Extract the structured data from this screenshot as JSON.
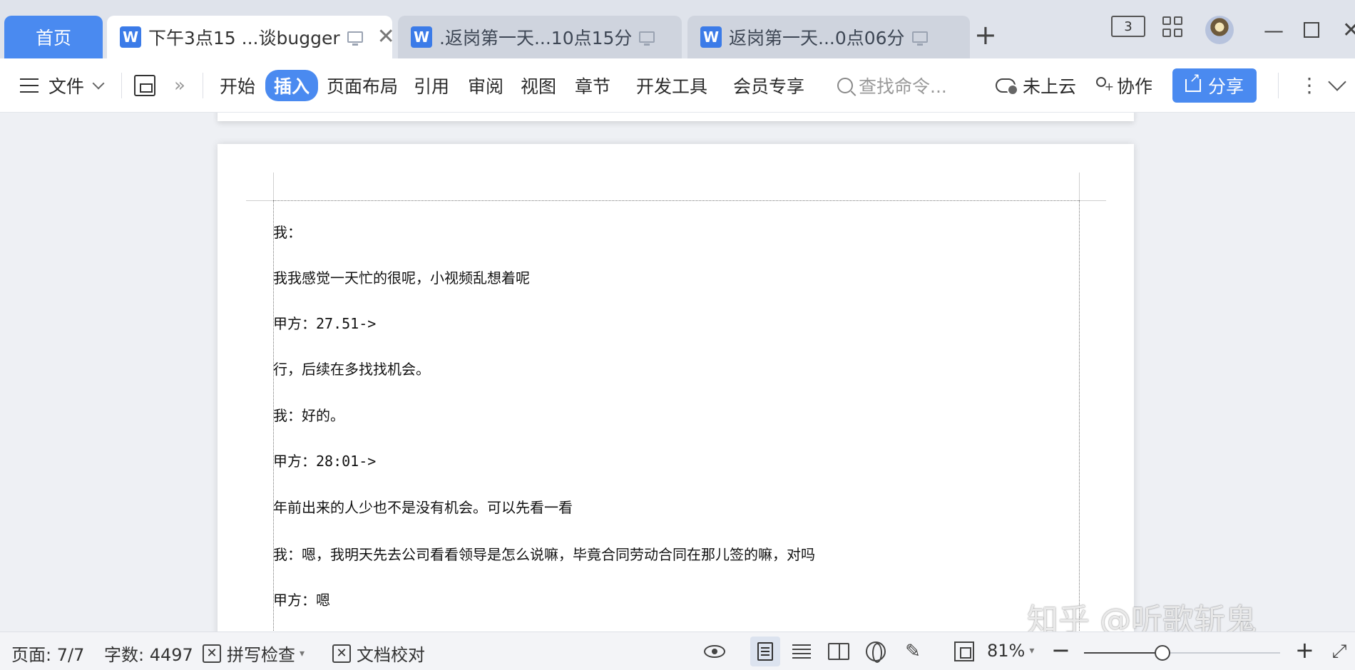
{
  "tabs": {
    "home": "首页",
    "items": [
      {
        "label": "下午3点15 ...谈bugger",
        "active": true
      },
      {
        "label": ".返岗第一天...10点15分",
        "active": false
      },
      {
        "label": "返岗第一天...0点06分",
        "active": false
      }
    ],
    "new_tab": "+",
    "badge": "3"
  },
  "ribbon": {
    "file": "文件",
    "more": "»",
    "menu": [
      "开始",
      "插入",
      "页面布局",
      "引用",
      "审阅",
      "视图",
      "章节",
      "开发工具",
      "会员专享"
    ],
    "active_menu": "插入",
    "search_placeholder": "查找命令...",
    "cloud": "未上云",
    "collab": "协作",
    "share": "分享"
  },
  "document": {
    "paragraphs": [
      "我：",
      "我我感觉一天忙的很呢，小视频乱想着呢",
      "甲方：27.51->",
      "行，后续在多找找机会。",
      "我：好的。",
      "甲方：28:01->",
      "年前出来的人少也不是没有机会。可以先看一看",
      "我：嗯，我明天先去公司看看领导是怎么说嘛，毕竟合同劳动合同在那儿签的嘛，对吗",
      "甲方：嗯"
    ]
  },
  "watermark": "知乎 @听歌斩鬼",
  "status": {
    "page": "页面: 7/7",
    "words": "字数: 4497",
    "spellcheck": "拼写检查",
    "proofread": "文档校对",
    "zoom": "81%",
    "zoom_level": 0.4
  },
  "colors": {
    "accent": "#4a8af0",
    "tabbar": "#dfe3eb"
  }
}
